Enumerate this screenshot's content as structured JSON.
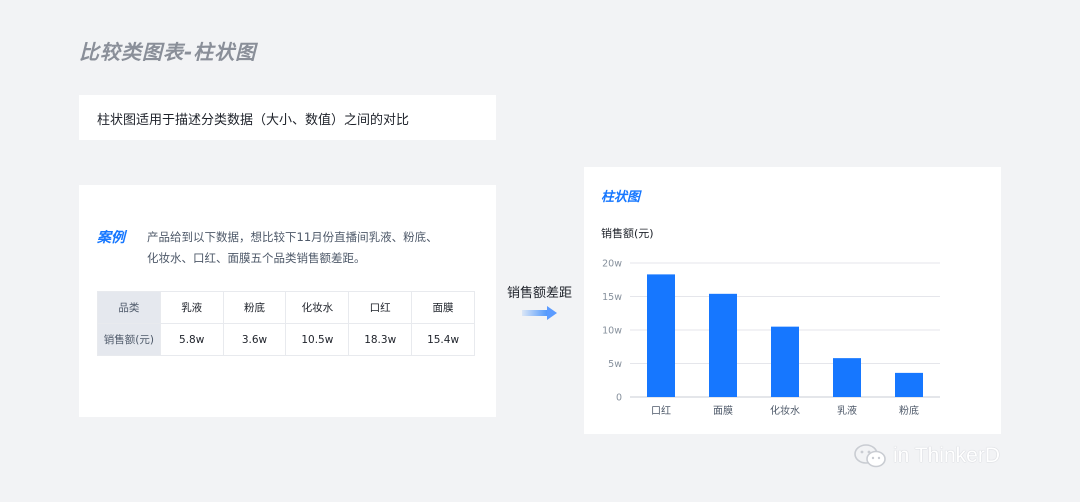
{
  "page_title": "比较类图表-柱状图",
  "description": "柱状图适用于描述分类数据（大小、数值）之间的对比",
  "case": {
    "tag": "案例",
    "text": "产品给到以下数据，想比较下11月份直播间乳液、粉底、化妆水、口红、面膜五个品类销售额差距。",
    "table": {
      "header_label": "品类",
      "categories": [
        "乳液",
        "粉底",
        "化妆水",
        "口红",
        "面膜"
      ],
      "row_label": "销售额(元)",
      "values": [
        "5.8w",
        "3.6w",
        "10.5w",
        "18.3w",
        "15.4w"
      ]
    }
  },
  "transition_label": "销售额差距",
  "chart_card_title": "柱状图",
  "chart_data": {
    "type": "bar",
    "title": "",
    "xlabel": "",
    "ylabel": "销售额(元)",
    "categories": [
      "口红",
      "面膜",
      "化妆水",
      "乳液",
      "粉底"
    ],
    "values": [
      18.3,
      15.4,
      10.5,
      5.8,
      3.6
    ],
    "ylim": [
      0,
      20
    ],
    "yticks": [
      0,
      5,
      10,
      15,
      20
    ],
    "ytick_labels": [
      "0",
      "5w",
      "10w",
      "15w",
      "20w"
    ],
    "bar_color": "#1677ff",
    "grid": true
  },
  "watermark": "in ThinkerD",
  "colors": {
    "accent": "#1677ff",
    "background": "#f2f3f5",
    "table_header": "#e5e8ee"
  }
}
